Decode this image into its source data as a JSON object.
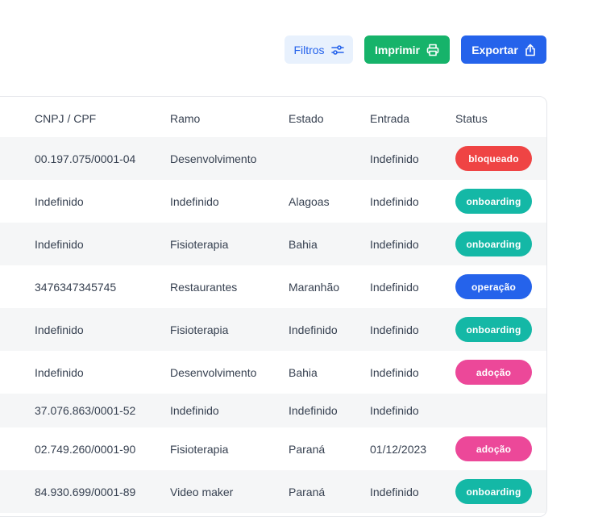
{
  "toolbar": {
    "filter_label": "Filtros",
    "print_label": "Imprimir",
    "export_label": "Exportar"
  },
  "table": {
    "headers": [
      "CNPJ / CPF",
      "Ramo",
      "Estado",
      "Entrada",
      "Status"
    ],
    "rows": [
      {
        "doc": "00.197.075/0001-04",
        "ramo": "Desenvolvimento",
        "estado": "",
        "entrada": "Indefinido",
        "status": "bloqueado"
      },
      {
        "doc": "Indefinido",
        "ramo": "Indefinido",
        "estado": "Alagoas",
        "entrada": "Indefinido",
        "status": "onboarding"
      },
      {
        "doc": "Indefinido",
        "ramo": "Fisioterapia",
        "estado": "Bahia",
        "entrada": "Indefinido",
        "status": "onboarding"
      },
      {
        "doc": "3476347345745",
        "ramo": "Restaurantes",
        "estado": "Maranhão",
        "entrada": "Indefinido",
        "status": "operação"
      },
      {
        "doc": "Indefinido",
        "ramo": "Fisioterapia",
        "estado": "Indefinido",
        "entrada": "Indefinido",
        "status": "onboarding"
      },
      {
        "doc": "Indefinido",
        "ramo": "Desenvolvimento",
        "estado": "Bahia",
        "entrada": "Indefinido",
        "status": "adoção"
      },
      {
        "doc": "37.076.863/0001-52",
        "ramo": "Indefinido",
        "estado": "Indefinido",
        "entrada": "Indefinido",
        "status": ""
      },
      {
        "doc": "02.749.260/0001-90",
        "ramo": "Fisioterapia",
        "estado": "Paraná",
        "entrada": "01/12/2023",
        "status": "adoção"
      },
      {
        "doc": "84.930.699/0001-89",
        "ramo": "Video maker",
        "estado": "Paraná",
        "entrada": "Indefinido",
        "status": "onboarding"
      }
    ]
  },
  "status_colors": {
    "bloqueado": "#ef4444",
    "onboarding": "#14b8a6",
    "operação": "#2563eb",
    "adoção": "#ec4899"
  }
}
